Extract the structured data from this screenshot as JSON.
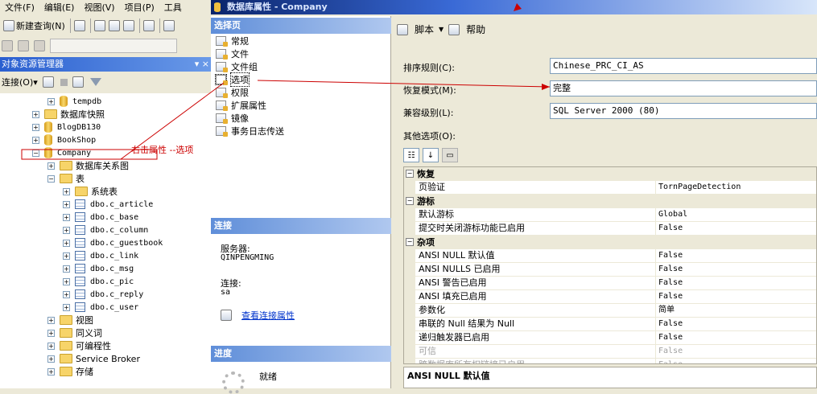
{
  "menubar": [
    "文件(F)",
    "编辑(E)",
    "视图(V)",
    "项目(P)",
    "工具"
  ],
  "toolbar": {
    "new_query": "新建查询(N)"
  },
  "object_explorer": {
    "title": "对象资源管理器",
    "pin": "▾ ×",
    "connect_label": "连接(O)▾"
  },
  "tree": [
    {
      "label": "tempdb",
      "type": "db",
      "level": 1
    },
    {
      "label": "数据库快照",
      "type": "folder",
      "level": 0
    },
    {
      "label": "BlogDB130",
      "type": "db",
      "level": 0
    },
    {
      "label": "BookShop",
      "type": "db",
      "level": 0
    },
    {
      "label": "Company",
      "type": "db",
      "level": 0,
      "expanded": true
    },
    {
      "label": "数据库关系图",
      "type": "folder",
      "level": 1
    },
    {
      "label": "表",
      "type": "folder",
      "level": 1,
      "expanded": true
    },
    {
      "label": "系统表",
      "type": "folder",
      "level": 2
    },
    {
      "label": "dbo.c_article",
      "type": "table",
      "level": 2
    },
    {
      "label": "dbo.c_base",
      "type": "table",
      "level": 2
    },
    {
      "label": "dbo.c_column",
      "type": "table",
      "level": 2
    },
    {
      "label": "dbo.c_guestbook",
      "type": "table",
      "level": 2
    },
    {
      "label": "dbo.c_link",
      "type": "table",
      "level": 2
    },
    {
      "label": "dbo.c_msg",
      "type": "table",
      "level": 2
    },
    {
      "label": "dbo.c_pic",
      "type": "table",
      "level": 2
    },
    {
      "label": "dbo.c_reply",
      "type": "table",
      "level": 2
    },
    {
      "label": "dbo.c_user",
      "type": "table",
      "level": 2
    },
    {
      "label": "视图",
      "type": "folder",
      "level": 1
    },
    {
      "label": "同义词",
      "type": "folder",
      "level": 1
    },
    {
      "label": "可编程性",
      "type": "folder",
      "level": 1
    },
    {
      "label": "Service Broker",
      "type": "folder",
      "level": 1
    },
    {
      "label": "存储",
      "type": "folder",
      "level": 1
    }
  ],
  "dialog": {
    "title": "数据库属性 - Company",
    "select_page_header": "选择页",
    "pages": [
      "常规",
      "文件",
      "文件组",
      "选项",
      "权限",
      "扩展属性",
      "镜像",
      "事务日志传送"
    ],
    "selected_page": 3,
    "connection_header": "连接",
    "server_label": "服务器:",
    "server_value": "QINPENGMING",
    "connection_label": "连接:",
    "connection_value": "sa",
    "view_connection_link": "查看连接属性",
    "progress_header": "进度",
    "progress_status": "就绪",
    "toolbar": {
      "script": "脚本",
      "help": "帮助"
    },
    "fields": [
      {
        "label": "排序规则(C):",
        "value": "Chinese_PRC_CI_AS"
      },
      {
        "label": "恢复模式(M):",
        "value": "完整"
      },
      {
        "label": "兼容级别(L):",
        "value": "SQL Server 2000 (80)"
      }
    ],
    "other_options_label": "其他选项(O):",
    "grid": [
      {
        "category": "恢复"
      },
      {
        "name": "页验证",
        "value": "TornPageDetection"
      },
      {
        "category": "游标"
      },
      {
        "name": "默认游标",
        "value": "Global"
      },
      {
        "name": "提交时关闭游标功能已启用",
        "value": "False"
      },
      {
        "category": "杂项"
      },
      {
        "name": "ANSI NULL 默认值",
        "value": "False"
      },
      {
        "name": "ANSI NULLS 已启用",
        "value": "False"
      },
      {
        "name": "ANSI 警告已启用",
        "value": "False"
      },
      {
        "name": "ANSI 填充已启用",
        "value": "False"
      },
      {
        "name": "参数化",
        "value": "简单"
      },
      {
        "name": "串联的 Null 结果为 Null",
        "value": "False"
      },
      {
        "name": "递归触发器已启用",
        "value": "False"
      },
      {
        "name": "可信",
        "value": "False",
        "dim": true
      },
      {
        "name": "跨数据库所有权链接已启用",
        "value": "False",
        "dim": true
      }
    ],
    "description": "ANSI NULL 默认值"
  },
  "annotation": {
    "text": "右击属性  --选项",
    "color": "#cc0000"
  }
}
